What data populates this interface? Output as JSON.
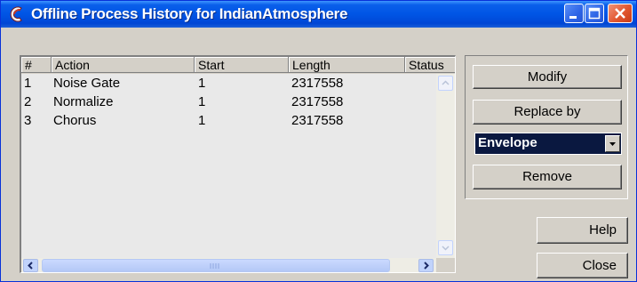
{
  "window": {
    "title": "Offline Process History for IndianAtmosphere"
  },
  "table": {
    "columns": [
      "#",
      "Action",
      "Start",
      "Length",
      "Status"
    ],
    "rows": [
      {
        "num": "1",
        "action": "Noise Gate",
        "start": "1",
        "length": "2317558",
        "status": ""
      },
      {
        "num": "2",
        "action": "Normalize",
        "start": "1",
        "length": "2317558",
        "status": ""
      },
      {
        "num": "3",
        "action": "Chorus",
        "start": "1",
        "length": "2317558",
        "status": ""
      }
    ]
  },
  "actions": {
    "modify": "Modify",
    "replace_by": "Replace by",
    "replace_select": "Envelope",
    "remove": "Remove",
    "help": "Help",
    "close": "Close"
  },
  "colors": {
    "titlebar": "#0055e5",
    "dialog_bg": "#d4d0c8",
    "list_bg": "#e9e9e9",
    "selected_combo_bg": "#0a1840",
    "close_button": "#e2572f"
  },
  "icons": {
    "app": "cubase-c-icon",
    "minimize": "minimize-icon",
    "maximize": "maximize-icon",
    "close": "close-icon"
  }
}
